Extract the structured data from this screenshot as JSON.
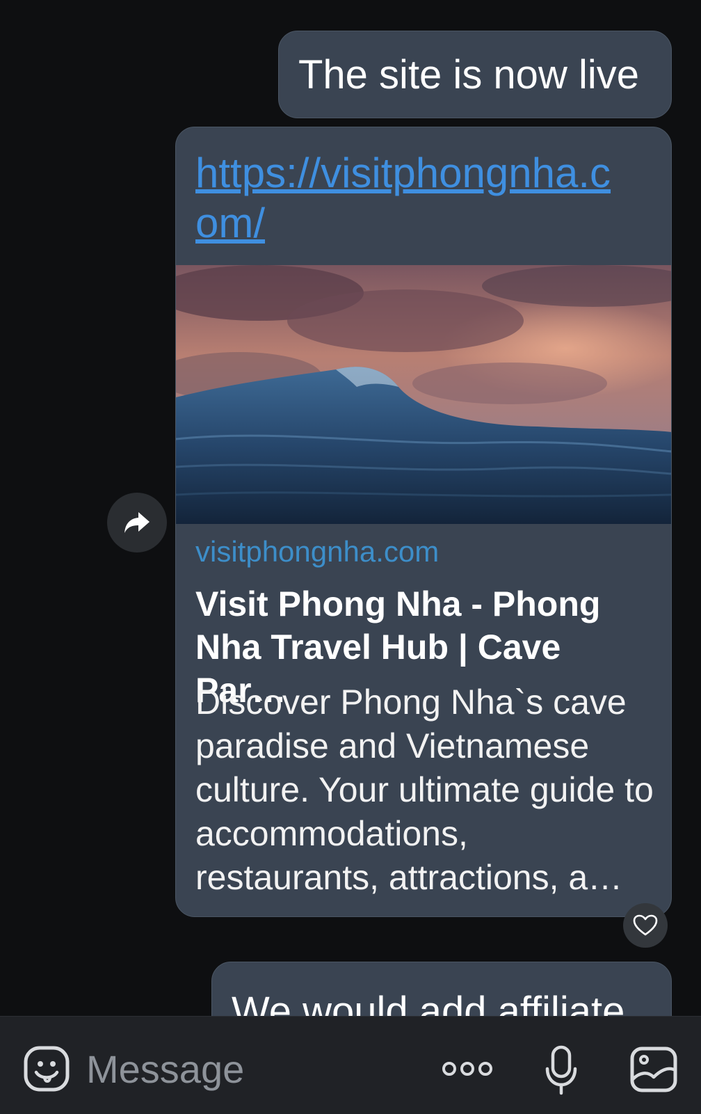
{
  "messages": [
    {
      "text": "The site is now live"
    },
    {
      "link_preview": {
        "url": "https://visitphongnha.com/",
        "domain": "visitphongnha.com",
        "title": "Visit Phong Nha - Phong Nha Travel Hub | Cave Par…",
        "description": "Discover Phong Nha`s cave paradise and Vietnamese culture. Your ultimate guide to accommodations, restaurants, attractions, a…"
      }
    },
    {
      "text": "We would add affiliate"
    }
  ],
  "actions": {
    "share_icon": "share-arrow-icon",
    "like_icon": "heart-icon"
  },
  "composer": {
    "placeholder": "Message",
    "icons": [
      "emoji-icon",
      "more-dots-icon",
      "microphone-icon",
      "gallery-icon"
    ]
  },
  "colors": {
    "background": "#0e0f11",
    "bubble": "#3a4452",
    "link": "#3f8fe0",
    "domain": "#3d8ec9",
    "input_bar": "#202226"
  }
}
